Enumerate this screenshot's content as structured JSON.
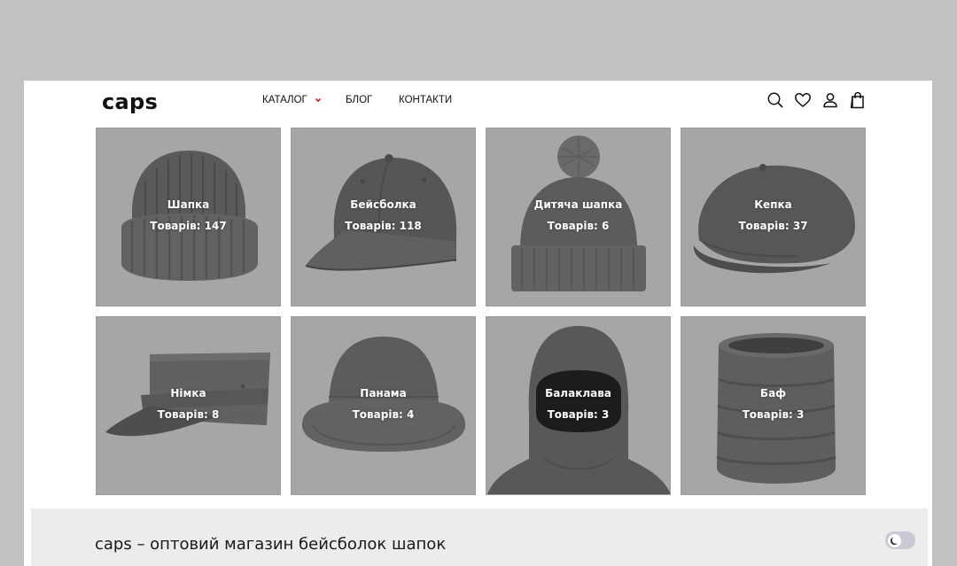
{
  "header": {
    "logo": "caps",
    "nav": [
      {
        "label": "КАТАЛОГ"
      },
      {
        "label": "БЛОГ"
      },
      {
        "label": "КОНТАКТИ"
      }
    ],
    "icons": [
      "search-icon",
      "heart-icon",
      "user-icon",
      "shopping-bag-icon"
    ],
    "accent_color": "#d0021b"
  },
  "categories": [
    {
      "name": "Шапка",
      "count": "Товарів: 147"
    },
    {
      "name": "Бейсболка",
      "count": "Товарів: 118"
    },
    {
      "name": "Дитяча шапка",
      "count": "Товарів: 6"
    },
    {
      "name": "Кепка",
      "count": "Товарів: 37"
    },
    {
      "name": "Німка",
      "count": "Товарів: 8"
    },
    {
      "name": "Панама",
      "count": "Товарів: 4"
    },
    {
      "name": "Балаклава",
      "count": "Товарів: 3"
    },
    {
      "name": "Баф",
      "count": "Товарів: 3"
    }
  ],
  "footer": {
    "tagline": "caps – оптовий магазин бейсболок шапок",
    "theme_toggle_icon": "moon-icon"
  }
}
